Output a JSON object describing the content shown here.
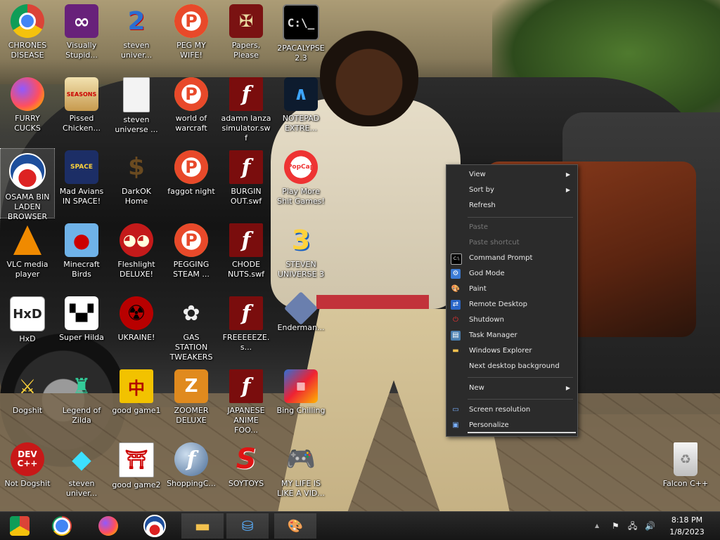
{
  "desktop": {
    "icons": [
      {
        "label": "CHRONES DISEASE",
        "icon": "chrome-icon"
      },
      {
        "label": "Visually Stupid...",
        "icon": "visual-studio-icon"
      },
      {
        "label": "steven univer...",
        "icon": "steven-universe-2-icon"
      },
      {
        "label": "PEG MY WIFE!",
        "icon": "peggle-icon"
      },
      {
        "label": "Papers, Please",
        "icon": "papers-please-icon"
      },
      {
        "label": "2PACALYPSE 2.3",
        "icon": "command-prompt-icon"
      },
      {
        "label": "FURRY CUCKS",
        "icon": "firefox-icon"
      },
      {
        "label": "Pissed Chicken...",
        "icon": "angry-birds-seasons-icon"
      },
      {
        "label": "steven universe ...",
        "icon": "blank-file-icon"
      },
      {
        "label": "world of warcraft",
        "icon": "peggle-icon"
      },
      {
        "label": "adamn lanza simulator.swf",
        "icon": "flash-file-icon"
      },
      {
        "label": "NOTEPAD EXTRE...",
        "icon": "notepad-icon"
      },
      {
        "label": "OSAMA BIN LADEN BROWSER",
        "icon": "obama-logo-icon"
      },
      {
        "label": "Mad Avians IN SPACE!",
        "icon": "angry-birds-space-icon"
      },
      {
        "label": "DarkOK Home",
        "icon": "money-bag-icon"
      },
      {
        "label": "faggot night",
        "icon": "peggle-nights-icon"
      },
      {
        "label": "BURGIN OUT.swf",
        "icon": "flash-file-icon"
      },
      {
        "label": "Play More Shit Games!",
        "icon": "popcap-icon"
      },
      {
        "label": "VLC media player",
        "icon": "vlc-icon"
      },
      {
        "label": "Minecraft Birds",
        "icon": "angry-birds-icon"
      },
      {
        "label": "Fleshlight DELUXE!",
        "icon": "red-fuzzy-icon"
      },
      {
        "label": "PEGGING STEAM ...",
        "icon": "peggle-icon"
      },
      {
        "label": "CHODE NUTS.swf",
        "icon": "flash-file-icon"
      },
      {
        "label": "STEVEN UNIVERSE 3",
        "icon": "number-three-icon"
      },
      {
        "label": "HxD",
        "icon": "hxd-icon"
      },
      {
        "label": "Super Hilda",
        "icon": "pixel-character-icon"
      },
      {
        "label": "UKRAINE!",
        "icon": "radiation-icon"
      },
      {
        "label": "GAS STATION TWEAKERS",
        "icon": "flower-icon"
      },
      {
        "label": "FREEEEEZE.s...",
        "icon": "flash-file-icon"
      },
      {
        "label": "Enderman...",
        "icon": "enderman-icon"
      },
      {
        "label": "Dogshit",
        "icon": "sword-cpp-icon"
      },
      {
        "label": "Legend of Zilda",
        "icon": "zelda-character-icon"
      },
      {
        "label": "good game1",
        "icon": "mahjong-icon"
      },
      {
        "label": "ZOOMER DELUXE",
        "icon": "zuma-icon"
      },
      {
        "label": "JAPANESE ANIME FOO...",
        "icon": "flash-file-icon"
      },
      {
        "label": "Bing Chilling",
        "icon": "tetris-icon"
      },
      {
        "label": "Not Dogshit",
        "icon": "dev-cpp-icon"
      },
      {
        "label": "steven univer...",
        "icon": "diamond-icon"
      },
      {
        "label": "good game2",
        "icon": "torii-gate-icon"
      },
      {
        "label": "ShoppingC...",
        "icon": "flash-player-icon"
      },
      {
        "label": "SOYTOYS",
        "icon": "red-s-icon"
      },
      {
        "label": "MY LIFE IS LIKE A VID...",
        "icon": "gamepad-icon"
      },
      {
        "label": "Falcon C++",
        "icon": "recycle-bin-icon"
      }
    ],
    "glyphs": {
      "vs": "∞",
      "peg": "P",
      "steven2": "2",
      "papers": "✠",
      "cmd": "C:\\_",
      "birds": "SEASONS",
      "flash": "f",
      "notepad": "∧",
      "space": "SPACE",
      "money": "$",
      "popcap": "PopCap",
      "angry": "●",
      "fleshlight": "◕◕",
      "three": "3",
      "hxd": "HxD",
      "hilda": "▚▞",
      "radiation": "☢",
      "flower": "✿",
      "sword": "⚔",
      "zilda": "♜",
      "mahjong": "中",
      "zoomer": "Z",
      "bing": "▦",
      "devc": "DEV C++",
      "diamond": "◆",
      "torii": "⛩",
      "soy": "S",
      "pad": "🎮",
      "recycle": "♻"
    }
  },
  "context_menu": {
    "items": [
      {
        "label": "View",
        "submenu": true
      },
      {
        "label": "Sort by",
        "submenu": true
      },
      {
        "label": "Refresh"
      },
      {
        "label": "Paste",
        "disabled": true
      },
      {
        "label": "Paste shortcut",
        "disabled": true
      },
      {
        "label": "Command Prompt",
        "icon": "command-prompt-icon"
      },
      {
        "label": "God Mode",
        "icon": "control-panel-icon"
      },
      {
        "label": "Paint",
        "icon": "paint-icon"
      },
      {
        "label": "Remote Desktop",
        "icon": "remote-desktop-icon"
      },
      {
        "label": "Shutdown",
        "icon": "shutdown-icon"
      },
      {
        "label": "Task Manager",
        "icon": "task-manager-icon"
      },
      {
        "label": "Windows Explorer",
        "icon": "folder-icon"
      },
      {
        "label": "Next desktop background"
      },
      {
        "label": "New",
        "submenu": true
      },
      {
        "label": "Screen resolution",
        "icon": "monitor-icon"
      },
      {
        "label": "Personalize",
        "icon": "personalize-icon"
      }
    ],
    "glyphs": {
      "cmd": "C:\\",
      "god": "⚙",
      "paint": "🎨",
      "remote": "⇄",
      "shutdown": "⏻",
      "task": "▤",
      "folder": "▬",
      "monitor": "▭",
      "personalize": "▣"
    }
  },
  "taskbar": {
    "items": [
      {
        "name": "start-orb",
        "icon": "start-icon"
      },
      {
        "name": "chrome",
        "icon": "chrome-icon"
      },
      {
        "name": "firefox",
        "icon": "firefox-icon"
      },
      {
        "name": "obama-browser",
        "icon": "obama-logo-icon"
      },
      {
        "name": "file-explorer",
        "icon": "folder-icon"
      },
      {
        "name": "network-app",
        "icon": "network-people-icon"
      },
      {
        "name": "paint",
        "icon": "paint-icon"
      }
    ],
    "glyphs": {
      "folder": "▬",
      "network": "⛁",
      "paint": "🎨"
    },
    "tray": {
      "chevron": "▲",
      "flag": "⚑",
      "network": "🖧",
      "volume": "🔊"
    },
    "clock": {
      "time": "8:18 PM",
      "date": "1/8/2023"
    }
  },
  "colors": {
    "accent": "#2b2b2b",
    "taskbar": "#1b1b1b",
    "menu_text": "#e8e8e8"
  }
}
